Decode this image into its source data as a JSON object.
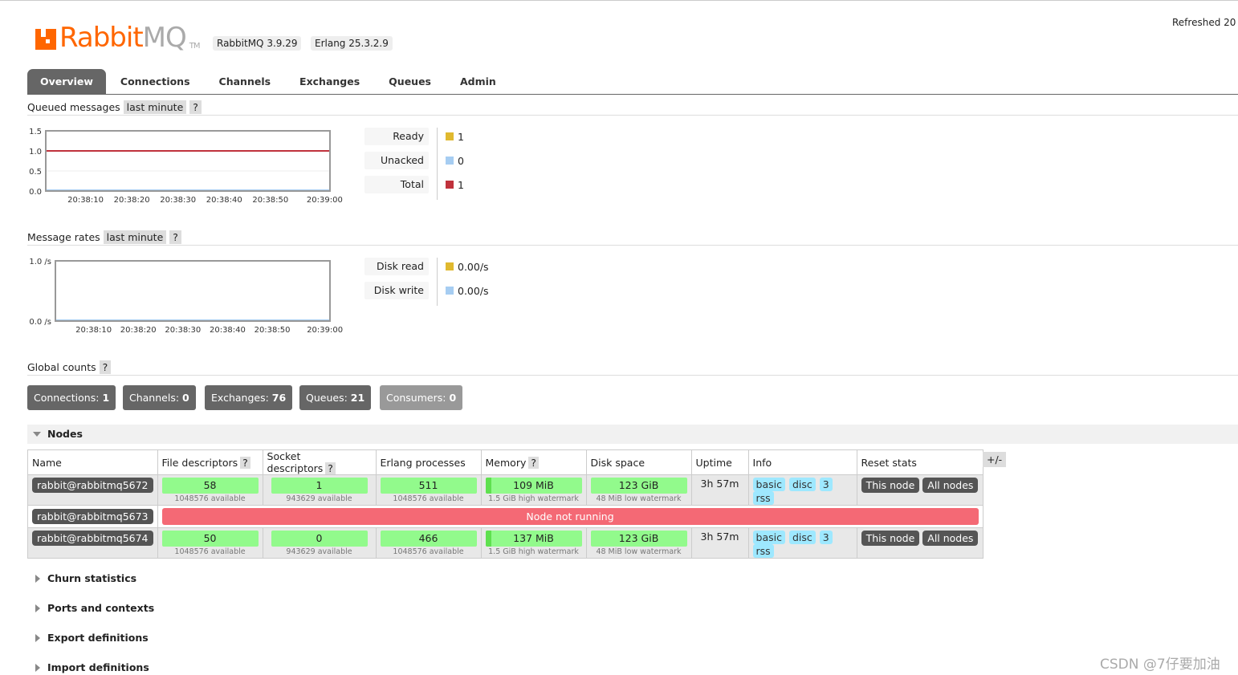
{
  "header": {
    "logo": {
      "brand": "Rabbit",
      "mq": "MQ",
      "tm": "TM"
    },
    "version": "RabbitMQ 3.9.29",
    "erlang": "Erlang 25.3.2.9",
    "refreshed": "Refreshed 20"
  },
  "tabs": [
    "Overview",
    "Connections",
    "Channels",
    "Exchanges",
    "Queues",
    "Admin"
  ],
  "queued": {
    "title": "Queued messages",
    "range": "last minute",
    "help": "?",
    "chart_data": {
      "type": "line",
      "x": [
        "20:38:10",
        "20:38:20",
        "20:38:30",
        "20:38:40",
        "20:38:50",
        "20:39:00"
      ],
      "yticks": [
        "0.0",
        "0.5",
        "1.0",
        "1.5"
      ],
      "ylim": [
        0,
        1.5
      ],
      "series": [
        {
          "name": "Ready",
          "color": "#e0b92f",
          "values": [
            1,
            1,
            1,
            1,
            1,
            1
          ]
        },
        {
          "name": "Unacked",
          "color": "#a6cdf2",
          "values": [
            0,
            0,
            0,
            0,
            0,
            0
          ]
        },
        {
          "name": "Total",
          "color": "#c0323c",
          "values": [
            1,
            1,
            1,
            1,
            1,
            1
          ]
        }
      ]
    },
    "legend": [
      {
        "label": "Ready",
        "value": "1",
        "color": "#e0b92f"
      },
      {
        "label": "Unacked",
        "value": "0",
        "color": "#a6cdf2"
      },
      {
        "label": "Total",
        "value": "1",
        "color": "#c0323c"
      }
    ]
  },
  "rates": {
    "title": "Message rates",
    "range": "last minute",
    "help": "?",
    "chart_data": {
      "type": "line",
      "x": [
        "20:38:10",
        "20:38:20",
        "20:38:30",
        "20:38:40",
        "20:38:50",
        "20:39:00"
      ],
      "yticks": [
        "0.0 /s",
        "1.0 /s"
      ],
      "ylim": [
        0,
        1
      ],
      "series": [
        {
          "name": "Disk read",
          "color": "#e0b92f",
          "values": [
            0,
            0,
            0,
            0,
            0,
            0
          ]
        },
        {
          "name": "Disk write",
          "color": "#a6cdf2",
          "values": [
            0,
            0,
            0,
            0,
            0,
            0
          ]
        }
      ]
    },
    "legend": [
      {
        "label": "Disk read",
        "value": "0.00/s",
        "color": "#e0b92f"
      },
      {
        "label": "Disk write",
        "value": "0.00/s",
        "color": "#a6cdf2"
      }
    ]
  },
  "global": {
    "title": "Global counts",
    "help": "?",
    "counts": [
      {
        "label": "Connections:",
        "value": "1"
      },
      {
        "label": "Channels:",
        "value": "0"
      },
      {
        "label": "Exchanges:",
        "value": "76"
      },
      {
        "label": "Queues:",
        "value": "21"
      },
      {
        "label": "Consumers:",
        "value": "0"
      }
    ]
  },
  "nodes": {
    "title": "Nodes",
    "plusminus": "+/-",
    "columns": [
      "Name",
      "File descriptors",
      "Socket descriptors",
      "Erlang processes",
      "Memory",
      "Disk space",
      "Uptime",
      "Info",
      "Reset stats"
    ],
    "help": "?",
    "rows": [
      {
        "name": "rabbit@rabbitmq5672",
        "fd": "58",
        "fd_sub": "1048576 available",
        "sd": "1",
        "sd_sub": "943629 available",
        "ep": "511",
        "ep_sub": "1048576 available",
        "mem": "109 MiB",
        "mem_sub": "1.5 GiB high watermark",
        "disk": "123 GiB",
        "disk_sub": "48 MiB low watermark",
        "uptime": "3h 57m",
        "info": [
          "basic",
          "disc",
          "3",
          "rss"
        ],
        "reset": [
          "This node",
          "All nodes"
        ]
      },
      {
        "name": "rabbit@rabbitmq5673",
        "status": "Node not running"
      },
      {
        "name": "rabbit@rabbitmq5674",
        "fd": "50",
        "fd_sub": "1048576 available",
        "sd": "0",
        "sd_sub": "943629 available",
        "ep": "466",
        "ep_sub": "1048576 available",
        "mem": "137 MiB",
        "mem_sub": "1.5 GiB high watermark",
        "disk": "123 GiB",
        "disk_sub": "48 MiB low watermark",
        "uptime": "3h 57m",
        "info": [
          "basic",
          "disc",
          "3",
          "rss"
        ],
        "reset": [
          "This node",
          "All nodes"
        ]
      }
    ]
  },
  "sections": [
    "Churn statistics",
    "Ports and contexts",
    "Export definitions",
    "Import definitions"
  ],
  "watermark": "CSDN @7仔要加油"
}
